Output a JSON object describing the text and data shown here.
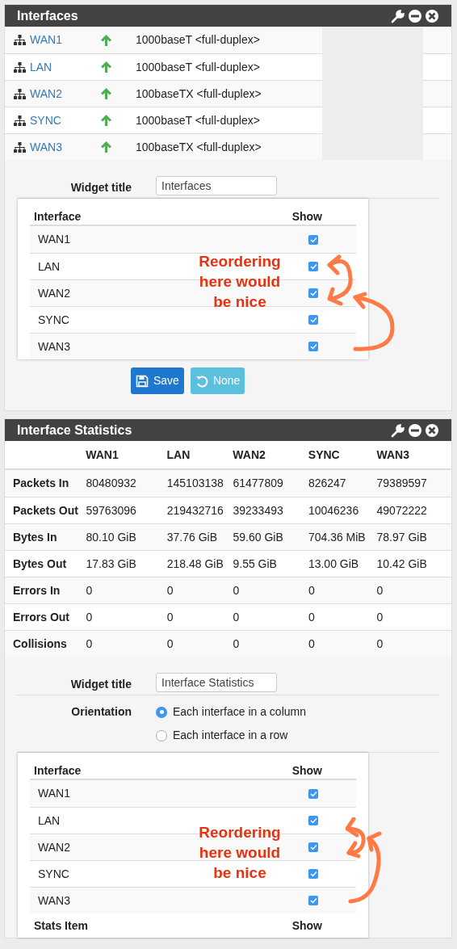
{
  "interfaces_widget": {
    "title": "Interfaces",
    "rows": [
      {
        "name": "WAN1",
        "link_up": true,
        "media": "1000baseT <full-duplex>"
      },
      {
        "name": "LAN",
        "link_up": true,
        "media": "1000baseT <full-duplex>"
      },
      {
        "name": "WAN2",
        "link_up": true,
        "media": "100baseTX <full-duplex>"
      },
      {
        "name": "SYNC",
        "link_up": true,
        "media": "1000baseT <full-duplex>"
      },
      {
        "name": "WAN3",
        "link_up": true,
        "media": "100baseTX <full-duplex>"
      }
    ],
    "config": {
      "widget_title_label": "Widget title",
      "widget_title_value": "Interfaces",
      "list": {
        "columns": [
          "Interface",
          "Show"
        ],
        "items": [
          {
            "name": "WAN1",
            "checked": true
          },
          {
            "name": "LAN",
            "checked": true
          },
          {
            "name": "WAN2",
            "checked": true
          },
          {
            "name": "SYNC",
            "checked": true
          },
          {
            "name": "WAN3",
            "checked": true
          }
        ],
        "note": "Reordering here would be nice"
      },
      "buttons": [
        {
          "kind": "save",
          "label": "Save"
        },
        {
          "kind": "none",
          "label": "None"
        }
      ]
    }
  },
  "statistics_widget": {
    "title": "Interface Statistics",
    "columns": [
      "WAN1",
      "LAN",
      "WAN2",
      "SYNC",
      "WAN3"
    ],
    "rows": [
      {
        "label": "Packets In",
        "cells": [
          "80480932",
          "145103138",
          "61477809",
          "826247",
          "79389597"
        ]
      },
      {
        "label": "Packets Out",
        "cells": [
          "59763096",
          "219432716",
          "39233493",
          "10046236",
          "49072222"
        ]
      },
      {
        "label": "Bytes In",
        "cells": [
          "80.10 GiB",
          "37.76 GiB",
          "59.60 GiB",
          "704.36 MiB",
          "78.97 GiB"
        ]
      },
      {
        "label": "Bytes Out",
        "cells": [
          "17.83 GiB",
          "218.48 GiB",
          "9.55 GiB",
          "13.00 GiB",
          "10.42 GiB"
        ]
      },
      {
        "label": "Errors In",
        "cells": [
          "0",
          "0",
          "0",
          "0",
          "0"
        ]
      },
      {
        "label": "Errors Out",
        "cells": [
          "0",
          "0",
          "0",
          "0",
          "0"
        ]
      },
      {
        "label": "Collisions",
        "cells": [
          "0",
          "0",
          "0",
          "0",
          "0"
        ]
      }
    ],
    "config": {
      "widget_title_label": "Widget title",
      "widget_title_value": "Interface Statistics",
      "orientation_label": "Orientation",
      "orientation_options": [
        {
          "label": "Each interface in a column",
          "selected": true
        },
        {
          "label": "Each interface in a row",
          "selected": false
        }
      ],
      "list": {
        "columns": [
          "Interface",
          "Show"
        ],
        "items": [
          {
            "name": "WAN1",
            "checked": true
          },
          {
            "name": "LAN",
            "checked": true
          },
          {
            "name": "WAN2",
            "checked": true
          },
          {
            "name": "SYNC",
            "checked": true
          },
          {
            "name": "WAN3",
            "checked": true
          }
        ],
        "note": "Reordering here would be nice"
      },
      "stats_list_header": [
        "Stats Item",
        "Show"
      ]
    }
  }
}
